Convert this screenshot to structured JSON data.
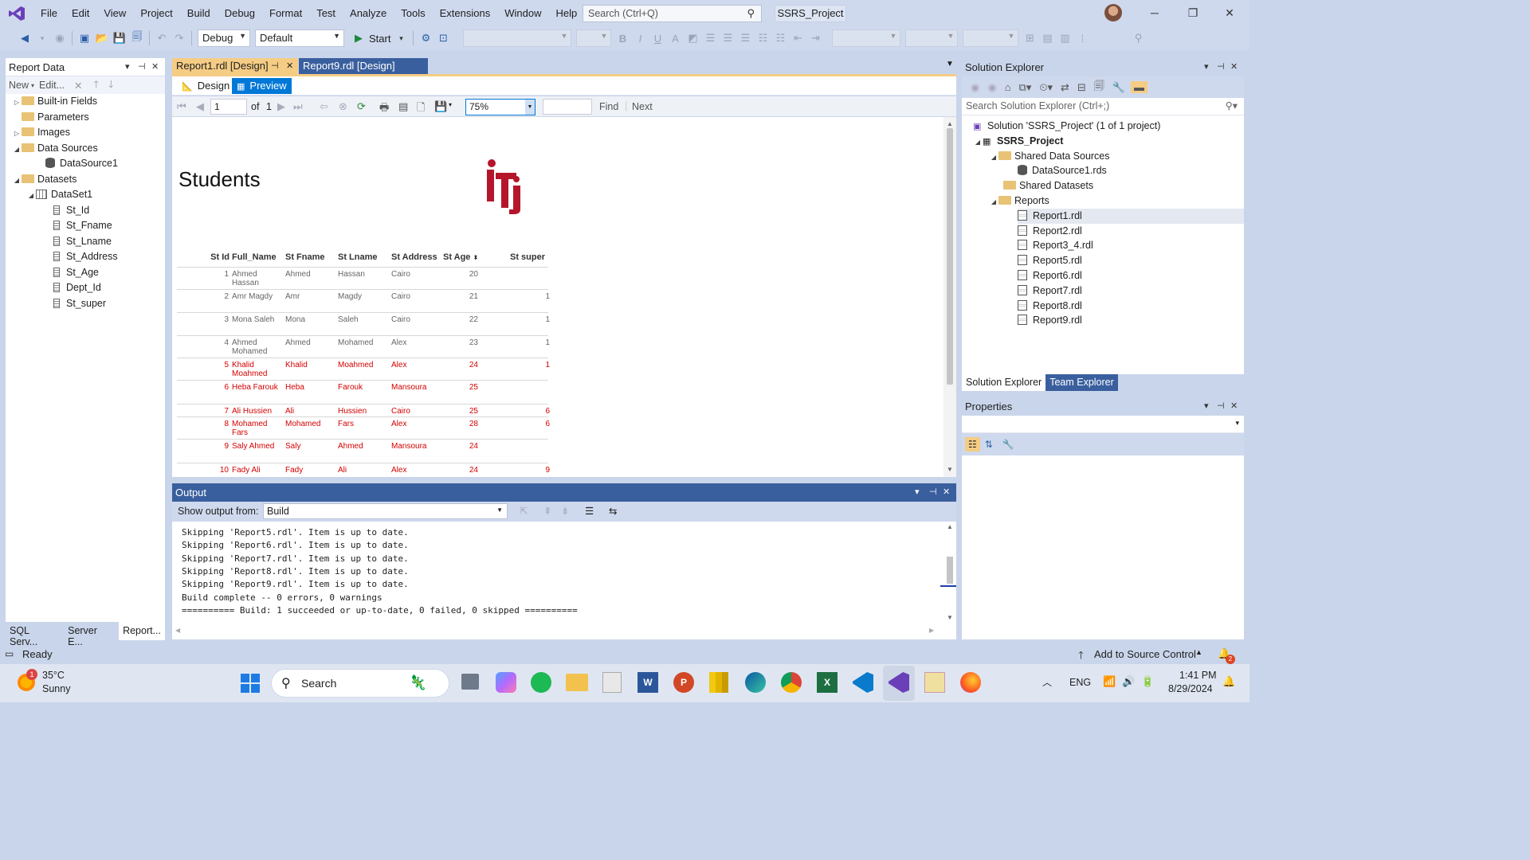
{
  "menu": {
    "items": [
      "File",
      "Edit",
      "View",
      "Project",
      "Build",
      "Debug",
      "Format",
      "Test",
      "Analyze",
      "Tools",
      "Extensions",
      "Window",
      "Help"
    ],
    "search_placeholder": "Search (Ctrl+Q)",
    "project_title": "SSRS_Project"
  },
  "toolbar": {
    "config": "Debug",
    "platform": "Default",
    "start_label": "Start"
  },
  "report_data": {
    "title": "Report Data",
    "new_label": "New",
    "edit_label": "Edit...",
    "tree": [
      {
        "label": "Built-in Fields",
        "expander": "▷"
      },
      {
        "label": "Parameters",
        "expander": ""
      },
      {
        "label": "Images",
        "expander": "▷"
      },
      {
        "label": "Data Sources",
        "expander": "◢"
      },
      {
        "label": "DataSource1",
        "expander": ""
      },
      {
        "label": "Datasets",
        "expander": "◢"
      },
      {
        "label": "DataSet1",
        "expander": "◢"
      },
      {
        "label": "St_Id"
      },
      {
        "label": "St_Fname"
      },
      {
        "label": "St_Lname"
      },
      {
        "label": "St_Address"
      },
      {
        "label": "St_Age"
      },
      {
        "label": "Dept_Id"
      },
      {
        "label": "St_super"
      }
    ],
    "bottom_tabs": [
      "SQL Serv...",
      "Server E...",
      "Report..."
    ]
  },
  "doc_tabs": [
    {
      "label": "Report1.rdl [Design]",
      "pin": "⊣",
      "close": "✕"
    },
    {
      "label": "Report9.rdl [Design]"
    }
  ],
  "view_tabs": {
    "design": "Design",
    "preview": "Preview"
  },
  "report_toolbar": {
    "page": "1",
    "of_label": "of",
    "total_pages": "1",
    "zoom": "75%",
    "find_label": "Find",
    "next_label": "Next"
  },
  "report": {
    "title": "Students",
    "logo_text": "iti",
    "columns": [
      "St Id",
      "Full_Name",
      "St Fname",
      "St Lname",
      "St Address",
      "St Age",
      "St super"
    ],
    "rows": [
      {
        "id": "1",
        "full": "Ahmed Hassan",
        "fname": "Ahmed",
        "lname": "Hassan",
        "addr": "Cairo",
        "age": "20",
        "sup": "",
        "red": false
      },
      {
        "id": "2",
        "full": "Amr Magdy",
        "fname": "Amr",
        "lname": "Magdy",
        "addr": "Cairo",
        "age": "21",
        "sup": "1",
        "red": false
      },
      {
        "id": "3",
        "full": "Mona Saleh",
        "fname": "Mona",
        "lname": "Saleh",
        "addr": "Cairo",
        "age": "22",
        "sup": "1",
        "red": false
      },
      {
        "id": "4",
        "full": "Ahmed Mohamed",
        "fname": "Ahmed",
        "lname": "Mohamed",
        "addr": "Alex",
        "age": "23",
        "sup": "1",
        "red": false
      },
      {
        "id": "5",
        "full": "Khalid Moahmed",
        "fname": "Khalid",
        "lname": "Moahmed",
        "addr": "Alex",
        "age": "24",
        "sup": "1",
        "red": true
      },
      {
        "id": "6",
        "full": "Heba Farouk",
        "fname": "Heba",
        "lname": "Farouk",
        "addr": "Mansoura",
        "age": "25",
        "sup": "",
        "red": true
      },
      {
        "id": "7",
        "full": "Ali Hussien",
        "fname": "Ali",
        "lname": "Hussien",
        "addr": "Cairo",
        "age": "25",
        "sup": "6",
        "red": true
      },
      {
        "id": "8",
        "full": "Mohamed Fars",
        "fname": "Mohamed",
        "lname": "Fars",
        "addr": "Alex",
        "age": "28",
        "sup": "6",
        "red": true
      },
      {
        "id": "9",
        "full": "Saly Ahmed",
        "fname": "Saly",
        "lname": "Ahmed",
        "addr": "Mansoura",
        "age": "24",
        "sup": "",
        "red": true
      },
      {
        "id": "10",
        "full": "Fady Ali",
        "fname": "Fady",
        "lname": "Ali",
        "addr": "Alex",
        "age": "24",
        "sup": "9",
        "red": true
      }
    ]
  },
  "solution_explorer": {
    "title": "Solution Explorer",
    "search_placeholder": "Search Solution Explorer (Ctrl+;)",
    "tree": [
      {
        "label": "Solution 'SSRS_Project' (1 of 1 project)"
      },
      {
        "label": "SSRS_Project"
      },
      {
        "label": "Shared Data Sources"
      },
      {
        "label": "DataSource1.rds"
      },
      {
        "label": "Shared Datasets"
      },
      {
        "label": "Reports"
      },
      {
        "label": "Report1.rdl"
      },
      {
        "label": "Report2.rdl"
      },
      {
        "label": "Report3_4.rdl"
      },
      {
        "label": "Report5.rdl"
      },
      {
        "label": "Report6.rdl"
      },
      {
        "label": "Report7.rdl"
      },
      {
        "label": "Report8.rdl"
      },
      {
        "label": "Report9.rdl"
      }
    ],
    "tabs": [
      "Solution Explorer",
      "Team Explorer"
    ]
  },
  "properties": {
    "title": "Properties"
  },
  "output": {
    "title": "Output",
    "show_from_label": "Show output from:",
    "source": "Build",
    "lines": [
      "Skipping 'Report5.rdl'. Item is up to date.",
      "Skipping 'Report6.rdl'. Item is up to date.",
      "Skipping 'Report7.rdl'. Item is up to date.",
      "Skipping 'Report8.rdl'. Item is up to date.",
      "Skipping 'Report9.rdl'. Item is up to date.",
      "Build complete -- 0 errors, 0 warnings",
      "========== Build: 1 succeeded or up-to-date, 0 failed, 0 skipped =========="
    ]
  },
  "status": {
    "ready": "Ready",
    "source_control": "Add to Source Control",
    "notif_count": "2"
  },
  "taskbar": {
    "weather_temp": "35°C",
    "weather_desc": "Sunny",
    "weather_badge": "1",
    "search_label": "Search",
    "lang": "ENG",
    "time": "1:41 PM",
    "date": "8/29/2024"
  },
  "colors": {
    "accent": "#0078d7",
    "report_red": "#d40000",
    "iti_red": "#b5152b"
  }
}
